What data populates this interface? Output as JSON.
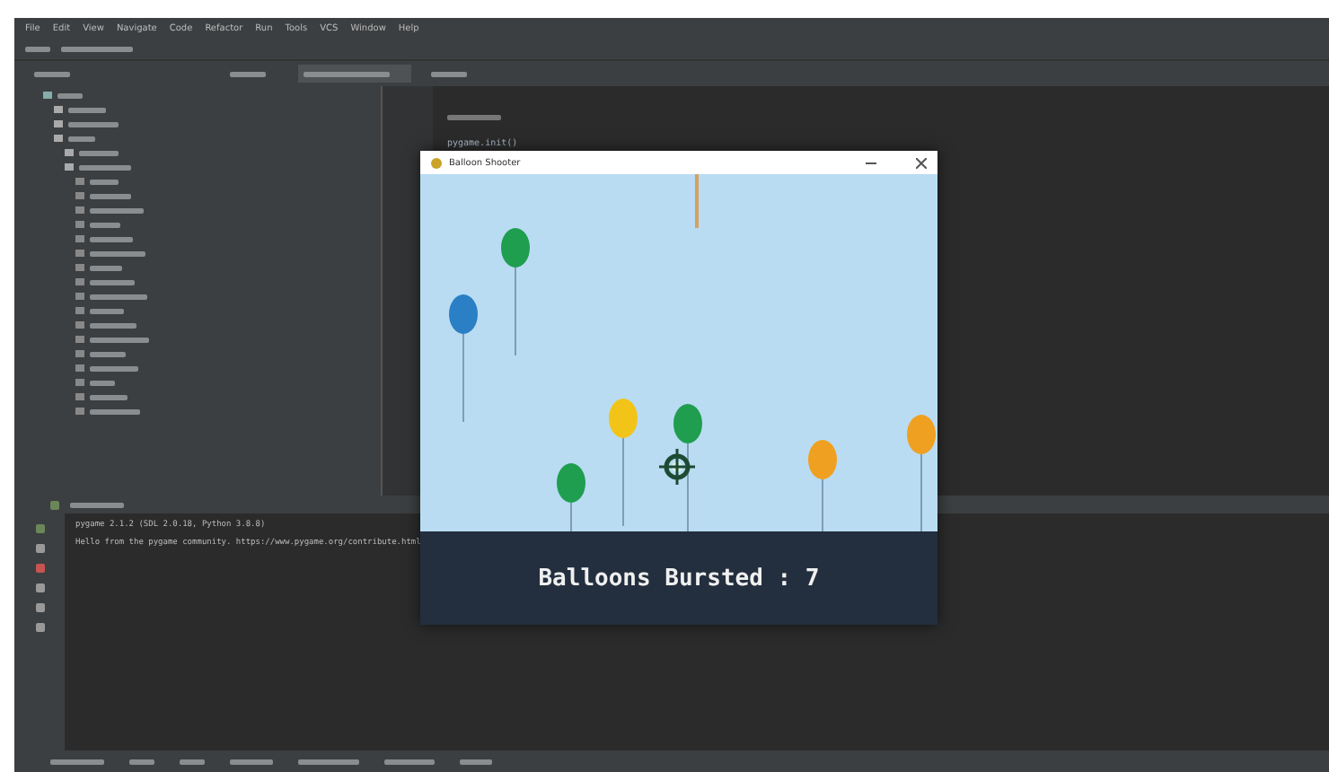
{
  "menu": [
    "File",
    "Edit",
    "View",
    "Navigate",
    "Code",
    "Refactor",
    "Run",
    "Tools",
    "VCS",
    "Window",
    "Help"
  ],
  "editor_tabs": [
    {
      "selected": false
    },
    {
      "selected": true
    },
    {
      "selected": false
    }
  ],
  "editor": {
    "code_line": "pygame.init()"
  },
  "game": {
    "title": "Balloon Shooter",
    "score": "Balloons Bursted : 7",
    "balloons": [
      {
        "color": "#1f9e4f"
      },
      {
        "color": "#2b7fc4"
      },
      {
        "color": "#f2c418"
      },
      {
        "color": "#1f9e4f"
      },
      {
        "color": "#1f9e4f"
      },
      {
        "color": "#f0a020"
      },
      {
        "color": "#f0a020"
      }
    ]
  },
  "console": {
    "lines": [
      "pygame 2.1.2 (SDL 2.0.18, Python 3.8.8)",
      "Hello from the pygame community. https://www.pygame.org/contribute.html"
    ]
  }
}
